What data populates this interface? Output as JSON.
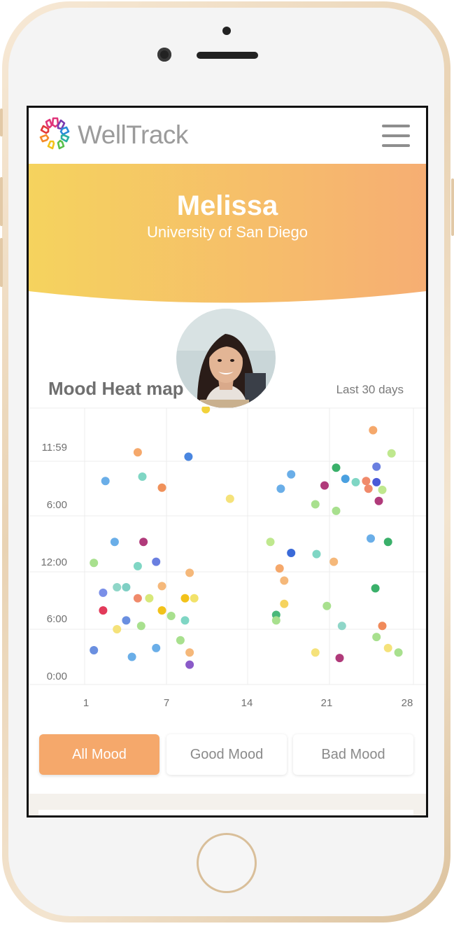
{
  "app": {
    "brand": "WellTrack"
  },
  "profile": {
    "name": "Melissa",
    "school": "University of San Diego"
  },
  "heatmap": {
    "title": "Mood Heat map",
    "range_label": "Last 30 days"
  },
  "filters": {
    "all": "All Mood",
    "good": "Good Mood",
    "bad": "Bad Mood",
    "selected": "All Mood"
  },
  "colors": {
    "accent": "#f5a86b",
    "hero_start": "#f5d35e",
    "hero_end": "#f6ae73"
  },
  "icons": {
    "menu": "hamburger-icon",
    "logo": "welltrack-logo-icon"
  },
  "chart_data": {
    "type": "scatter",
    "title": "",
    "xlabel": "",
    "ylabel": "",
    "xticks": [
      1,
      7,
      14,
      21,
      28
    ],
    "yticks": [
      "0:00",
      "6:00",
      "12:00",
      "6:00",
      "11:59"
    ],
    "xlim": [
      0,
      28.5
    ],
    "ylim": [
      -1,
      24
    ],
    "grid": true,
    "points": [
      {
        "x": 1.8,
        "y": 17.4,
        "c": "#6aaee8"
      },
      {
        "x": 0.8,
        "y": 2.1,
        "c": "#6a8fe0"
      },
      {
        "x": 0.8,
        "y": 10.0,
        "c": "#a8e08e"
      },
      {
        "x": 1.6,
        "y": 7.3,
        "c": "#7a8fe8"
      },
      {
        "x": 1.6,
        "y": 5.7,
        "c": "#e23a5a"
      },
      {
        "x": 2.6,
        "y": 11.9,
        "c": "#6aaee8"
      },
      {
        "x": 2.8,
        "y": 7.8,
        "c": "#8fd6c8"
      },
      {
        "x": 2.8,
        "y": 4.0,
        "c": "#f5e27a"
      },
      {
        "x": 3.6,
        "y": 7.8,
        "c": "#7fcfc4"
      },
      {
        "x": 3.6,
        "y": 4.8,
        "c": "#6a8fe0"
      },
      {
        "x": 4.1,
        "y": 1.5,
        "c": "#6aaee8"
      },
      {
        "x": 4.6,
        "y": 20.0,
        "c": "#f5a86b"
      },
      {
        "x": 4.6,
        "y": 9.7,
        "c": "#7fd6c4"
      },
      {
        "x": 4.6,
        "y": 6.8,
        "c": "#f08a6b"
      },
      {
        "x": 4.9,
        "y": 4.3,
        "c": "#a8e08e"
      },
      {
        "x": 5.0,
        "y": 17.8,
        "c": "#7fd6c4"
      },
      {
        "x": 5.1,
        "y": 11.9,
        "c": "#b03a7a"
      },
      {
        "x": 5.6,
        "y": 6.8,
        "c": "#d7e87a"
      },
      {
        "x": 6.2,
        "y": 10.1,
        "c": "#6a7fe0"
      },
      {
        "x": 6.2,
        "y": 2.3,
        "c": "#6aaee8"
      },
      {
        "x": 6.7,
        "y": 7.9,
        "c": "#f5b87a"
      },
      {
        "x": 6.7,
        "y": 5.7,
        "c": "#f2c21a"
      },
      {
        "x": 6.7,
        "y": 16.8,
        "c": "#f0915a"
      },
      {
        "x": 7.5,
        "y": 5.2,
        "c": "#a8e08e"
      },
      {
        "x": 8.3,
        "y": 3.0,
        "c": "#a8e08e"
      },
      {
        "x": 8.7,
        "y": 6.8,
        "c": "#f2c21a"
      },
      {
        "x": 8.7,
        "y": 4.8,
        "c": "#7fd6c4"
      },
      {
        "x": 9.1,
        "y": 9.1,
        "c": "#f5b87a"
      },
      {
        "x": 9.1,
        "y": 1.9,
        "c": "#f5b87a"
      },
      {
        "x": 9.1,
        "y": 0.8,
        "c": "#8a5ac8"
      },
      {
        "x": 9.0,
        "y": 19.6,
        "c": "#4a86e0"
      },
      {
        "x": 9.5,
        "y": 6.8,
        "c": "#f2e26a"
      },
      {
        "x": 10.5,
        "y": 23.9,
        "c": "#f2d23a"
      },
      {
        "x": 11.0,
        "y": 25.2,
        "c": "#b03a7a"
      },
      {
        "x": 12.6,
        "y": 15.8,
        "c": "#f5e27a"
      },
      {
        "x": 16.1,
        "y": 11.9,
        "c": "#bfe88e"
      },
      {
        "x": 16.6,
        "y": 5.3,
        "c": "#4ab87a"
      },
      {
        "x": 16.6,
        "y": 4.8,
        "c": "#a8e08e"
      },
      {
        "x": 16.9,
        "y": 9.5,
        "c": "#f5a86b"
      },
      {
        "x": 17.0,
        "y": 16.7,
        "c": "#6aaee8"
      },
      {
        "x": 17.3,
        "y": 8.4,
        "c": "#f5b87a"
      },
      {
        "x": 17.3,
        "y": 6.3,
        "c": "#f5d35e"
      },
      {
        "x": 17.9,
        "y": 10.9,
        "c": "#3a6ad8"
      },
      {
        "x": 17.9,
        "y": 18.0,
        "c": "#6aaee8"
      },
      {
        "x": 20.0,
        "y": 15.3,
        "c": "#a8e08e"
      },
      {
        "x": 20.0,
        "y": 1.9,
        "c": "#f5e27a"
      },
      {
        "x": 20.1,
        "y": 10.8,
        "c": "#7fd6c4"
      },
      {
        "x": 20.8,
        "y": 17.0,
        "c": "#b03a7a"
      },
      {
        "x": 21.0,
        "y": 6.1,
        "c": "#a8e08e"
      },
      {
        "x": 21.6,
        "y": 10.1,
        "c": "#f5b87a"
      },
      {
        "x": 21.8,
        "y": 14.7,
        "c": "#a8e08e"
      },
      {
        "x": 21.8,
        "y": 18.6,
        "c": "#3ab06a"
      },
      {
        "x": 22.1,
        "y": 1.4,
        "c": "#b03a7a"
      },
      {
        "x": 22.3,
        "y": 4.3,
        "c": "#8fd6c8"
      },
      {
        "x": 22.6,
        "y": 17.6,
        "c": "#4aa0e0"
      },
      {
        "x": 23.5,
        "y": 17.3,
        "c": "#7fd6c4"
      },
      {
        "x": 24.4,
        "y": 17.4,
        "c": "#f08a6b"
      },
      {
        "x": 24.6,
        "y": 16.7,
        "c": "#f08a6b"
      },
      {
        "x": 24.8,
        "y": 12.2,
        "c": "#6aaee8"
      },
      {
        "x": 25.3,
        "y": 17.3,
        "c": "#4a5ad8"
      },
      {
        "x": 25.3,
        "y": 18.7,
        "c": "#6a7fe0"
      },
      {
        "x": 25.0,
        "y": 22.0,
        "c": "#f5a86b"
      },
      {
        "x": 25.5,
        "y": 15.6,
        "c": "#b03a7a"
      },
      {
        "x": 25.8,
        "y": 16.6,
        "c": "#bfe88e"
      },
      {
        "x": 25.8,
        "y": 4.3,
        "c": "#f08a5a"
      },
      {
        "x": 25.2,
        "y": 7.7,
        "c": "#3ab06a"
      },
      {
        "x": 25.3,
        "y": 3.3,
        "c": "#a8e08e"
      },
      {
        "x": 26.3,
        "y": 11.9,
        "c": "#3ab06a"
      },
      {
        "x": 26.3,
        "y": 2.3,
        "c": "#f5e27a"
      },
      {
        "x": 26.6,
        "y": 19.9,
        "c": "#bfe88e"
      },
      {
        "x": 27.2,
        "y": 1.9,
        "c": "#a8e08e"
      }
    ]
  }
}
